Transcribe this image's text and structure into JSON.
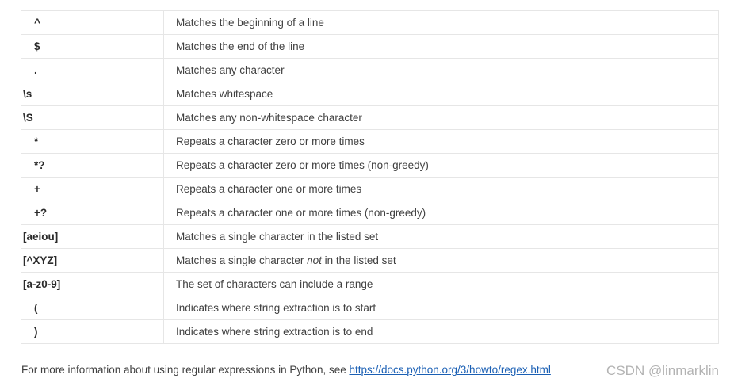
{
  "rows": [
    {
      "pattern": "^",
      "description": "Matches the beginning of a line"
    },
    {
      "pattern": "$",
      "description": "Matches the end of the line"
    },
    {
      "pattern": ".",
      "description": "Matches any character"
    },
    {
      "pattern": "\\s",
      "description": "Matches whitespace"
    },
    {
      "pattern": "\\S",
      "description": "Matches any non-whitespace character"
    },
    {
      "pattern": "*",
      "description": "Repeats a character zero or more times"
    },
    {
      "pattern": "*?",
      "description": "Repeats a character zero or more times (non-greedy)"
    },
    {
      "pattern": "+",
      "description": "Repeats a character one or more times"
    },
    {
      "pattern": "+?",
      "description": "Repeats a character one or more times (non-greedy)"
    },
    {
      "pattern": "[aeiou]",
      "description": "Matches a single character in the listed set"
    },
    {
      "pattern": "[^XYZ]",
      "description_parts": {
        "before": "Matches a single character ",
        "emphasis": "not",
        "after": " in the listed set"
      }
    },
    {
      "pattern": "[a-z0-9]",
      "description": "The set of characters can include a range"
    },
    {
      "pattern": "(",
      "description": "Indicates where string extraction is to start"
    },
    {
      "pattern": ")",
      "description": "Indicates where string extraction is to end"
    }
  ],
  "footer": {
    "text": "For more information about using regular expressions in Python, see ",
    "link_text": "https://docs.python.org/3/howto/regex.html"
  },
  "watermark": "CSDN @linmarklin",
  "colors": {
    "border": "#e6e6e6",
    "text": "#404040",
    "link": "#1a5fb4",
    "watermark": "#b3b3b3"
  }
}
